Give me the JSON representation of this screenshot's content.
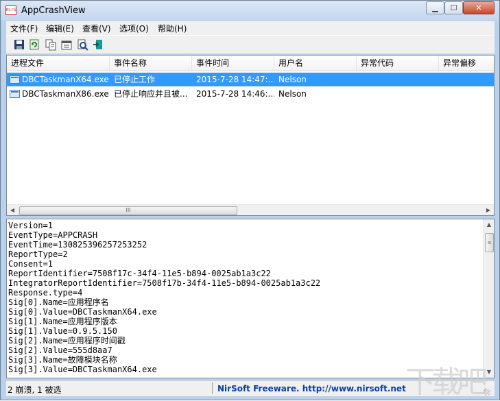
{
  "window": {
    "title": "AppCrashView",
    "icon_text": "NirS",
    "buttons": {
      "minimize": "▁",
      "maximize": "☐",
      "close": "✕"
    }
  },
  "menu": [
    "文件(F)",
    "编辑(E)",
    "查看(V)",
    "选项(O)",
    "帮助(H)"
  ],
  "toolbar": [
    {
      "icon": "save-icon",
      "glyph": "💾"
    },
    {
      "icon": "refresh-icon",
      "glyph": "⟳"
    },
    {
      "icon": "copy-icon",
      "glyph": "❐"
    },
    {
      "icon": "properties-icon",
      "glyph": "▦"
    },
    {
      "icon": "find-icon",
      "glyph": "🔍"
    },
    {
      "icon": "exit-icon",
      "glyph": "⇥"
    }
  ],
  "list": {
    "columns": [
      "进程文件",
      "事件名称",
      "事件时间",
      "用户名",
      "异常代码",
      "异常偏移"
    ],
    "rows": [
      {
        "cells": [
          "DBCTaskmanX64.exe",
          "已停止工作",
          "2015-7-28 14:47:...",
          "Nelson",
          "",
          ""
        ],
        "selected": true
      },
      {
        "cells": [
          "DBCTaskmanX86.exe",
          "已停止响应并且被...",
          "2015-7-28 14:46:...",
          "Nelson",
          "",
          ""
        ],
        "selected": false
      }
    ]
  },
  "hscroll": {
    "left": "◀",
    "right": "▶",
    "thumb": "III"
  },
  "vscroll": {
    "up": "▲",
    "down": "▼",
    "thumb": "≡"
  },
  "details_lines": [
    "Version=1",
    "EventType=APPCRASH",
    "EventTime=130825396257253252",
    "ReportType=2",
    "Consent=1",
    "ReportIdentifier=7508f17c-34f4-11e5-b894-0025ab1a3c22",
    "IntegratorReportIdentifier=7508f17b-34f4-11e5-b894-0025ab1a3c22",
    "Response.type=4",
    "Sig[0].Name=应用程序名",
    "Sig[0].Value=DBCTaskmanX64.exe",
    "Sig[1].Name=应用程序版本",
    "Sig[1].Value=0.9.5.150",
    "Sig[2].Name=应用程序时间戳",
    "Sig[2].Value=555d8aa7",
    "Sig[3].Name=故障模块名称",
    "Sig[3].Value=DBCTaskmanX64.exe"
  ],
  "status": {
    "left": "2 崩溃, 1 被选",
    "right": "NirSoft Freeware.  http://www.nirsoft.net"
  },
  "watermark": "下载吧",
  "colors": {
    "selection": "#3399ff",
    "link": "#0b3fa8"
  }
}
